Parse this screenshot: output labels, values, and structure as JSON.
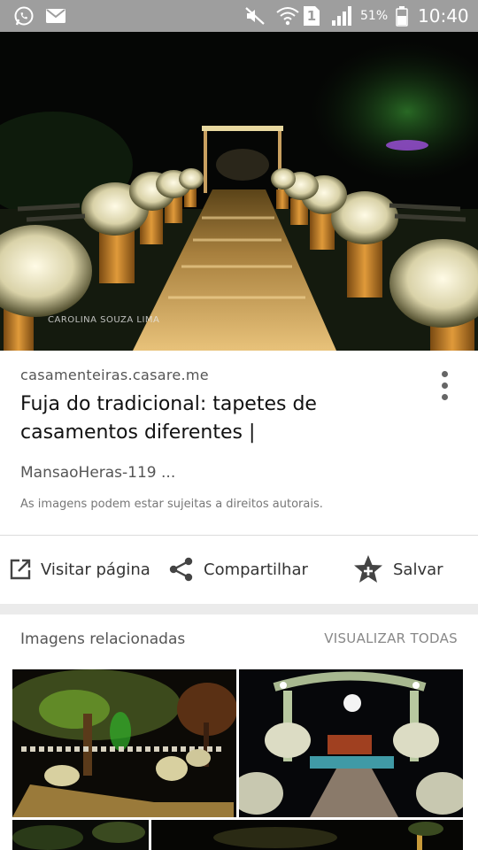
{
  "status_bar": {
    "battery_percent": "51%",
    "sim_badge": "1",
    "time": "10:40",
    "icons": [
      "whatsapp-icon",
      "email-icon",
      "mute-icon",
      "wifi-icon",
      "sim-icon",
      "signal-icon",
      "battery-icon"
    ]
  },
  "hero": {
    "watermark": "CAROLINA SOUZA LIMA"
  },
  "result": {
    "source": "casamenteiras.casare.me",
    "title": "Fuja do tradicional: tapetes de casamentos diferentes |",
    "subtitle": "MansaoHeras-119 ...",
    "copyright": "As imagens podem estar sujeitas a direitos autorais."
  },
  "actions": {
    "visit": "Visitar página",
    "share": "Compartilhar",
    "save": "Salvar"
  },
  "related": {
    "title": "Imagens relacionadas",
    "view_all": "VISUALIZAR TODAS"
  }
}
